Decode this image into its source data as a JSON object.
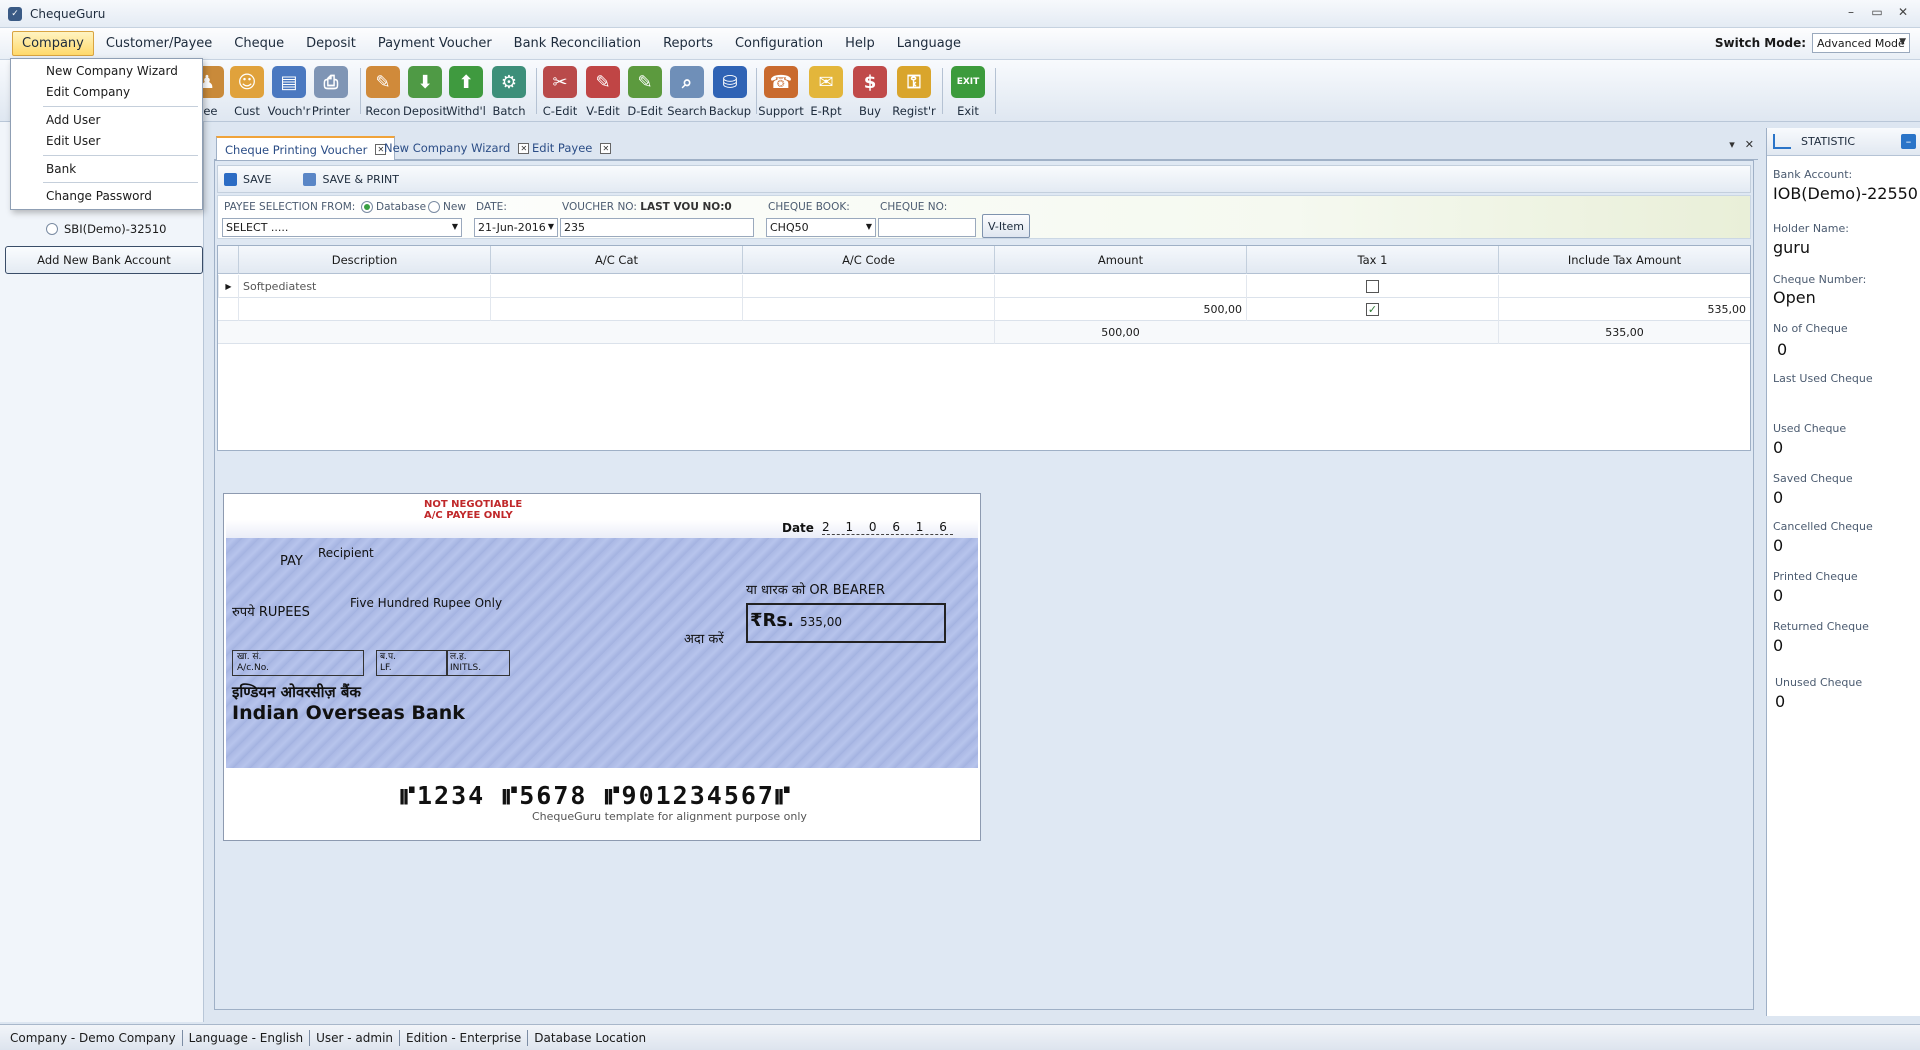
{
  "window": {
    "title": "ChequeGuru"
  },
  "menu": [
    "Company",
    "Customer/Payee",
    "Cheque",
    "Deposit",
    "Payment Voucher",
    "Bank Reconciliation",
    "Reports",
    "Configuration",
    "Help",
    "Language"
  ],
  "switch_mode": {
    "label": "Switch Mode:",
    "value": "Advanced Mode"
  },
  "toolbar": [
    "yee",
    "Cust",
    "Vouch'r",
    "Printer",
    "Recon",
    "Deposit",
    "Withd'l",
    "Batch",
    "C-Edit",
    "V-Edit",
    "D-Edit",
    "Search",
    "Backup",
    "Support",
    "E-Rpt",
    "Buy",
    "Regist'r",
    "Exit"
  ],
  "company_menu": [
    "New Company Wizard",
    "Edit Company",
    "Add User",
    "Edit User",
    "Bank",
    "Change Password"
  ],
  "left_panel": {
    "bank": "SBI(Demo)-32510",
    "add_bank": "Add New Bank Account"
  },
  "tabs": [
    "Cheque Printing Voucher",
    "New Company Wizard",
    "Edit Payee"
  ],
  "savebar": {
    "save": "SAVE",
    "save_print": "SAVE & PRINT"
  },
  "form": {
    "payee_label": "PAYEE SELECTION FROM:",
    "opt_database": "Database",
    "opt_new": "New",
    "payee_value": "SELECT .....",
    "date_label": "DATE:",
    "date_value": "21-Jun-2016",
    "voucher_label": "VOUCHER NO:",
    "last_vou": "LAST VOU NO:0",
    "voucher_value": "235",
    "book_label": "CHEQUE BOOK:",
    "book_value": "CHQ50",
    "chq_no_label": "CHEQUE No:",
    "chq_no_value": "",
    "vitem": "V-Item"
  },
  "grid": {
    "headers": [
      "Description",
      "A/C Cat",
      "A/C Code",
      "Amount",
      "Tax 1",
      "Include Tax Amount"
    ],
    "rows": [
      {
        "description": "Softpediatest",
        "amount": "",
        "tax": false,
        "include_tax": ""
      },
      {
        "description": "",
        "amount": "500,00",
        "tax": true,
        "include_tax": "535,00"
      }
    ],
    "totals": {
      "amount": "500,00",
      "include_tax": "535,00"
    }
  },
  "cheque": {
    "not_negotiable": "NOT NEGOTIABLE",
    "ac_payee": "A/C PAYEE ONLY",
    "date_label": "Date",
    "date_digits": "2 1 0 6 1 6",
    "pay": "PAY",
    "payee": "Recipient",
    "bearer": "या धारक को OR BEARER",
    "rupees": "रुपये RUPEES",
    "amount_words": "Five Hundred Rupee Only",
    "ada_karen": "अदा करें",
    "rs": "₹Rs.",
    "amount": "535,00",
    "box_ac": "खा. सं. A/c.No.",
    "box_lf": "ब.प. LF.",
    "box_inits": "ल.ह. INITLS.",
    "bank_hindi": "इण्डियन ओवरसीज़ बैंक",
    "bank_name": "Indian Overseas Bank",
    "micr": "⑈1234 ⑈5678 ⑈901234567⑈",
    "footer": "ChequeGuru template for alignment purpose only"
  },
  "statistic": {
    "title": "STATISTIC",
    "bank_account_label": "Bank Account:",
    "bank_account": "IOB(Demo)-22550",
    "holder_label": "Holder Name:",
    "holder": "guru",
    "cheque_number_label": "Cheque Number:",
    "cheque_number": "Open",
    "no_of_cheque_label": "No of Cheque",
    "no_of_cheque": "0",
    "last_used_label": "Last Used Cheque",
    "last_used": "",
    "used_label": "Used Cheque",
    "used": "0",
    "saved_label": "Saved Cheque",
    "saved": "0",
    "cancelled_label": "Cancelled Cheque",
    "cancelled": "0",
    "printed_label": "Printed Cheque",
    "printed": "0",
    "returned_label": "Returned Cheque",
    "returned": "0",
    "unused_label": "Unused Cheque",
    "unused": "0"
  },
  "statusbar": [
    "Company - Demo Company",
    "Language - English",
    "User - admin",
    "Edition - Enterprise",
    "Database Location"
  ]
}
